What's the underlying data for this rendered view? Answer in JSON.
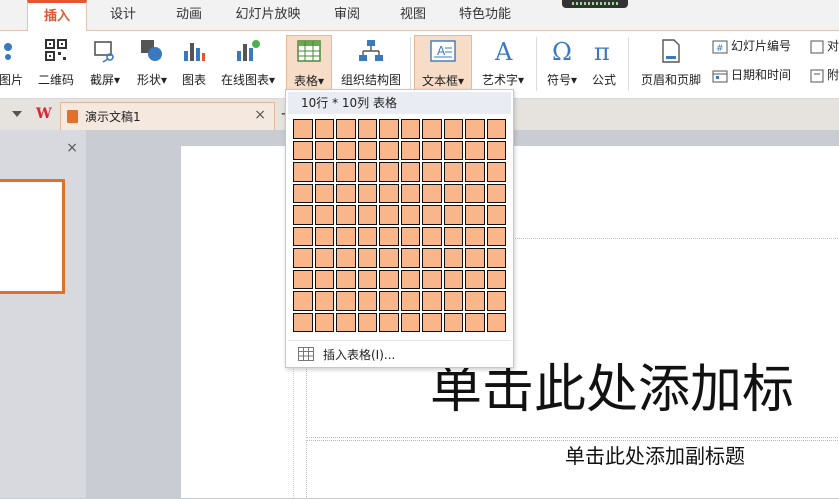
{
  "tabs": [
    "插入",
    "设计",
    "动画",
    "幻灯片放映",
    "审阅",
    "视图",
    "特色功能"
  ],
  "active_tab": "插入",
  "ribbon": {
    "picture": "图片",
    "qrcode": "二维码",
    "screenshot": "截屏",
    "shape": "形状",
    "chart": "图表",
    "online_chart": "在线图表",
    "table": "表格",
    "org_chart": "组织结构图",
    "textbox": "文本框",
    "wordart": "艺术字",
    "symbol": "符号",
    "formula": "公式",
    "header_footer": "页眉和页脚",
    "slide_number": "幻灯片编号",
    "date_time": "日期和时间",
    "object": "对",
    "attachment": "附",
    "dropdown_arrow": "▾"
  },
  "docbar": {
    "logo": "W",
    "doc_title": "演示文稿1",
    "close": "×",
    "new_tab": "+"
  },
  "left_pane": {
    "close": "×"
  },
  "table_dropdown": {
    "header": "10行 * 10列 表格",
    "rows": 10,
    "cols": 10,
    "insert_label": "插入表格(I)..."
  },
  "slide": {
    "title_placeholder": "单击此处添加标",
    "subtitle_placeholder": "单击此处添加副标题"
  },
  "colors": {
    "accent": "#e1582e",
    "cell_fill": "#f9b68a",
    "thumb_border": "#e0702a"
  }
}
